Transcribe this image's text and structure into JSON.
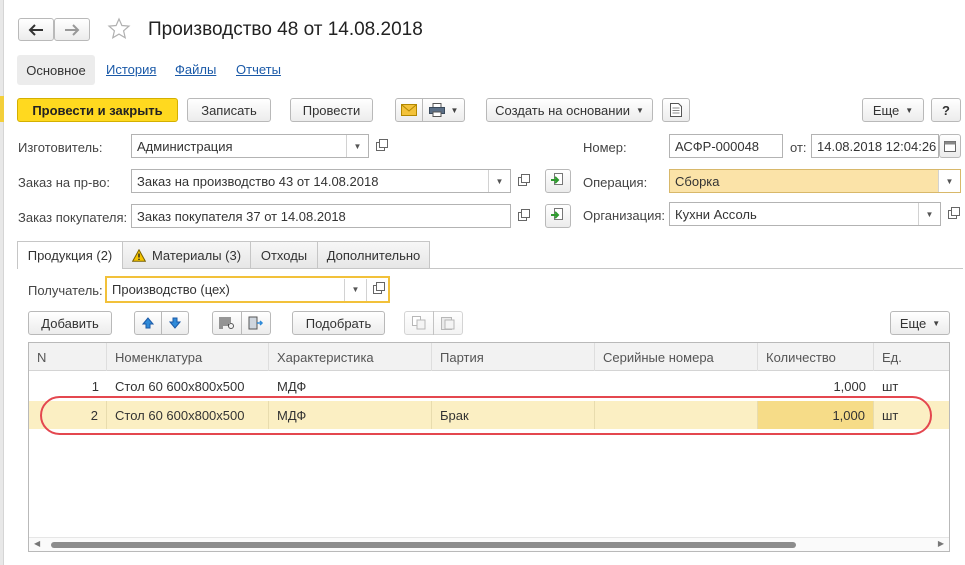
{
  "window": {
    "title": "Производство 48 от 14.08.2018"
  },
  "nav": {
    "back_icon": "arrow-left-icon",
    "forward_icon": "arrow-right-icon",
    "star_icon": "star-icon"
  },
  "subnav": {
    "items": [
      "Основное",
      "История",
      "Файлы",
      "Отчеты"
    ]
  },
  "toolbar": {
    "post_close": "Провести и закрыть",
    "save": "Записать",
    "post": "Провести",
    "create_based": "Создать на основании",
    "more": "Еще",
    "help": "?"
  },
  "form": {
    "manufacturer_label": "Изготовитель:",
    "manufacturer_value": "Администрация",
    "prod_order_label": "Заказ на пр-во:",
    "prod_order_value": "Заказ на производство 43 от 14.08.2018",
    "customer_order_label": "Заказ покупателя:",
    "customer_order_value": "Заказ покупателя 37 от 14.08.2018",
    "number_label": "Номер:",
    "number_value": "АСФР-000048",
    "date_label": "от:",
    "date_value": "14.08.2018 12:04:26",
    "operation_label": "Операция:",
    "operation_value": "Сборка",
    "org_label": "Организация:",
    "org_value": "Кухни Ассоль"
  },
  "tabs": [
    {
      "label": "Продукция (2)"
    },
    {
      "label": "Материалы (3)"
    },
    {
      "label": "Отходы"
    },
    {
      "label": "Дополнительно"
    }
  ],
  "products": {
    "recipient_label": "Получатель:",
    "recipient_value": "Производство (цех)",
    "add_button": "Добавить",
    "pick_button": "Подобрать",
    "more": "Еще",
    "columns": [
      "N",
      "Номенклатура",
      "Характеристика",
      "Партия",
      "Серийные номера",
      "Количество",
      "Ед."
    ],
    "rows": [
      {
        "n": "1",
        "item": "Стол 60 600x800x500",
        "characteristic": "МДФ",
        "batch": "",
        "serial": "",
        "qty": "1,000",
        "unit": "шт"
      },
      {
        "n": "2",
        "item": "Стол 60 600x800x500",
        "characteristic": "МДФ",
        "batch": "Брак",
        "serial": "",
        "qty": "1,000",
        "unit": "шт"
      }
    ]
  },
  "colors": {
    "accent": "#ffd91f",
    "highlight": "#fbefc3",
    "annotation": "#e4474f"
  }
}
